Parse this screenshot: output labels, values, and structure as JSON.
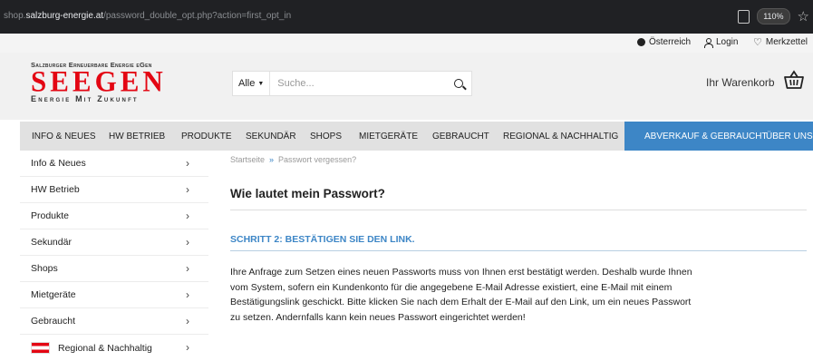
{
  "browser": {
    "url_prefix": "shop.",
    "url_domain": "salzburg-energie.at",
    "url_path": "/password_double_opt.php?action=first_opt_in",
    "zoom": "110%",
    "reader_icon": "reader-mode-icon",
    "bookmark_icon": "star-icon"
  },
  "topbar": {
    "country": "Österreich",
    "login": "Login",
    "wishlist": "Merkzettel"
  },
  "logo": {
    "tagline": "Salzburger Erneuerbare Energie eGen",
    "brand": "SEEGEN",
    "subline": "Energie Mit Zukunft",
    "brand_color": "#e30613"
  },
  "search": {
    "category": "Alle",
    "placeholder": "Suche..."
  },
  "cart": {
    "label": "Ihr Warenkorb"
  },
  "nav": {
    "items": [
      "INFO & NEUES",
      "HW BETRIEB",
      "PRODUKTE",
      "SEKUNDÄR",
      "SHOPS",
      "MIETGERÄTE",
      "GEBRAUCHT",
      "REGIONAL & NACHHALTIG",
      "ABVERKAUF & GEBRAUCHT",
      "ÜBER UNS"
    ],
    "accent_color": "#3d86c6"
  },
  "sidebar": {
    "items": [
      "Info & Neues",
      "HW Betrieb",
      "Produkte",
      "Sekundär",
      "Shops",
      "Mietgeräte",
      "Gebraucht",
      "Regional & Nachhaltig"
    ]
  },
  "breadcrumb": {
    "home": "Startseite",
    "separator": "»",
    "current": "Passwort vergessen?"
  },
  "content": {
    "title": "Wie lautet mein Passwort?",
    "step_title": "SCHRITT 2: BESTÄTIGEN SIE DEN LINK.",
    "body": "Ihre Anfrage zum Setzen eines neuen Passworts muss von Ihnen erst bestätigt werden. Deshalb wurde Ihnen vom System, sofern ein Kundenkonto für die angegebene E-Mail Adresse existiert, eine E-Mail mit einem Bestätigungslink geschickt. Bitte klicken Sie nach dem Erhalt der E-Mail auf den Link, um ein neues Passwort zu setzen. Andernfalls kann kein neues Passwort eingerichtet werden!"
  }
}
